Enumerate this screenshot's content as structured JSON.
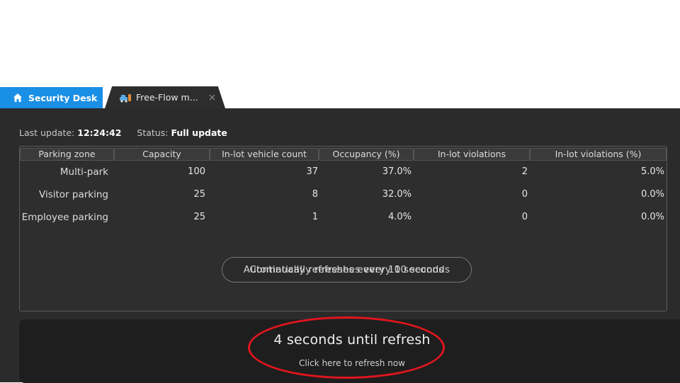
{
  "tabs": [
    {
      "label": "Security Desk",
      "icon": "home-icon",
      "active": true
    },
    {
      "label": "Free-Flow m...",
      "icon": "parking-vehicle-icon",
      "active": false,
      "close": "×"
    }
  ],
  "status": {
    "last_update_label": "Last update:",
    "last_update_value": "12:24:42",
    "status_label": "Status:",
    "status_value": "Full update"
  },
  "table": {
    "columns": [
      "Parking zone",
      "Capacity",
      "In-lot vehicle count",
      "Occupancy (%)",
      "In-lot violations",
      "In-lot violations (%)"
    ],
    "rows": [
      {
        "zone": "Multi-park",
        "capacity": "100",
        "count": "37",
        "occupancy": "37.0%",
        "violations": "2",
        "violations_pct": "5.0%"
      },
      {
        "zone": "Visitor parking",
        "capacity": "25",
        "count": "8",
        "occupancy": "32.0%",
        "violations": "0",
        "violations_pct": "0.0%"
      },
      {
        "zone": "Employee parking",
        "capacity": "25",
        "count": "1",
        "occupancy": "4.0%",
        "violations": "0",
        "violations_pct": "0.0%"
      }
    ]
  },
  "auto_refresh": {
    "text_a": "Automatically refreshes every 10 seconds",
    "text_b": "Continually refreshes every 10 seconds"
  },
  "refresh": {
    "countdown": "4 seconds until refresh",
    "link": "Click here to refresh now"
  },
  "colors": {
    "tab_active": "#1a8fe6",
    "background": "#2b2b2b",
    "highlight_ellipse": "#e0151e"
  }
}
